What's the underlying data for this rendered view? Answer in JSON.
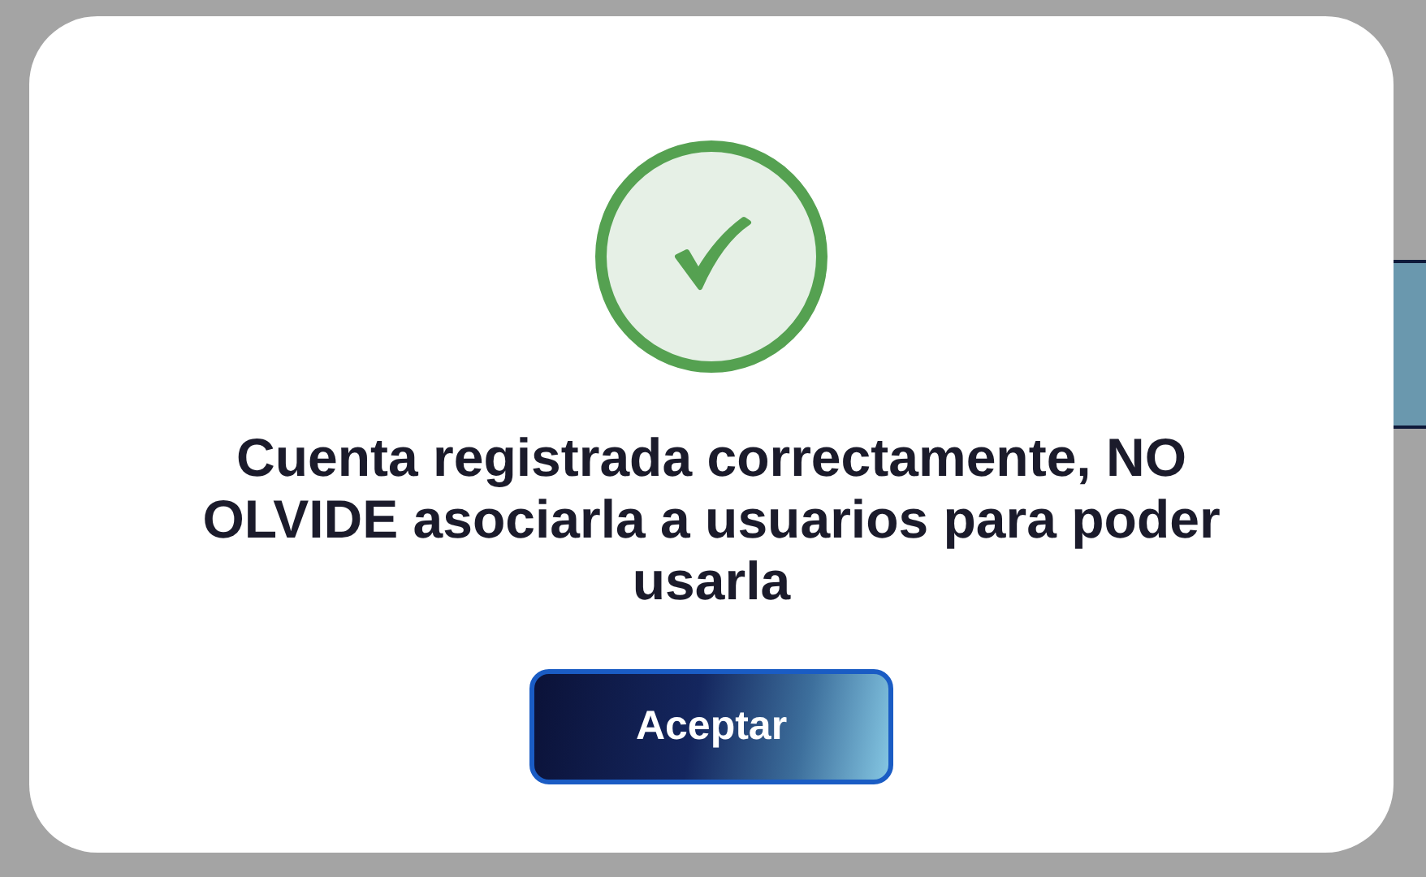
{
  "dialog": {
    "kind": "success",
    "message": "Cuenta registrada correctamente, NO OLVIDE asociarla a usuarios para poder usarla",
    "button": "Aceptar"
  }
}
